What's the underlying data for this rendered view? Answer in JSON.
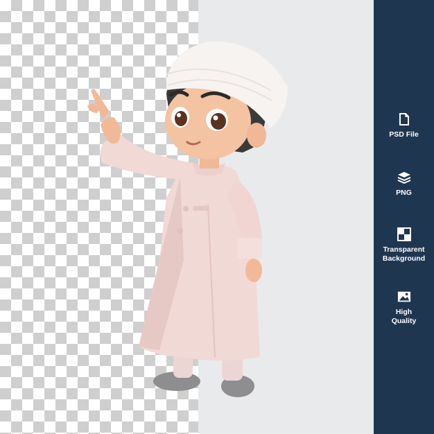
{
  "colors": {
    "sidebar_bg": "#1f3651",
    "plain_bg": "#e9eaec",
    "checker_dark": "#cfcfcf",
    "robe": "#f1d9d6",
    "cap": "#f7f3f1"
  },
  "features": [
    {
      "icon": "file-icon",
      "label": "PSD File"
    },
    {
      "icon": "layers-icon",
      "label": "PNG"
    },
    {
      "icon": "transparency-icon",
      "label": "Transparent\nBackground"
    },
    {
      "icon": "image-icon",
      "label": "High\nQuality"
    }
  ]
}
